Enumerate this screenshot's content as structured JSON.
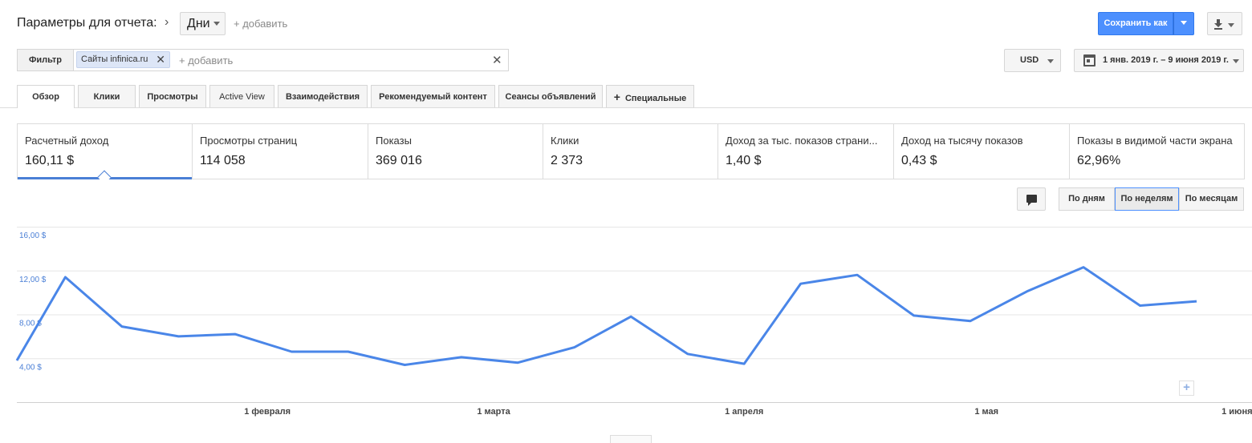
{
  "header": {
    "report_params_label": "Параметры для отчета:",
    "dimension_value": "Дни",
    "add_dimension": "+ добавить",
    "save_label": "Сохранить как"
  },
  "filter": {
    "label": "Фильтр",
    "chip_prefix": "Сайты ",
    "chip_value": "infinica.ru",
    "add_label": "+ добавить",
    "currency": "USD",
    "date_range": "1 янв. 2019 г. – 9 июня 2019 г."
  },
  "tabs": [
    {
      "label": "Обзор"
    },
    {
      "label": "Клики"
    },
    {
      "label": "Просмотры"
    },
    {
      "label": "Active View"
    },
    {
      "label": "Взаимодействия"
    },
    {
      "label": "Рекомендуемый контент"
    },
    {
      "label": "Сеансы объявлений"
    },
    {
      "label": "Специальные"
    }
  ],
  "metrics": [
    {
      "name": "Расчетный доход",
      "value": "160,11 $"
    },
    {
      "name": "Просмотры страниц",
      "value": "114 058"
    },
    {
      "name": "Показы",
      "value": "369 016"
    },
    {
      "name": "Клики",
      "value": "2 373"
    },
    {
      "name": "Доход за тыс. показов страни...",
      "value": "1,40 $"
    },
    {
      "name": "Доход на тысячу показов",
      "value": "0,43 $"
    },
    {
      "name": "Показы в видимой части экрана",
      "value": "62,96%"
    }
  ],
  "period_buttons": {
    "days": "По дням",
    "weeks": "По неделям",
    "months": "По месяцам",
    "selected": "weeks"
  },
  "colors": {
    "accent": "#4d90fe",
    "line": "#4a86e8",
    "axis_label": "#4a7fd6"
  },
  "icons": {
    "dimension_caret": "chevron-down-icon",
    "download": "download-icon",
    "calendar": "calendar-icon",
    "annotation": "comment-icon",
    "zoom": "plus-icon"
  },
  "chart_data": {
    "type": "line",
    "series": [
      {
        "values": [
          3.8,
          11.4,
          6.9,
          6.0,
          6.2,
          4.6,
          4.6,
          3.4,
          4.1,
          3.6,
          5.0,
          7.8,
          4.4,
          3.5,
          10.8,
          11.6,
          7.9,
          7.4,
          10.1,
          12.3,
          8.8,
          9.2
        ]
      }
    ],
    "x": [
      "2019-01-01",
      "2019-01-07",
      "2019-01-14",
      "2019-01-21",
      "2019-01-28",
      "2019-02-04",
      "2019-02-11",
      "2019-02-18",
      "2019-02-25",
      "2019-03-04",
      "2019-03-11",
      "2019-03-18",
      "2019-03-25",
      "2019-04-01",
      "2019-04-08",
      "2019-04-15",
      "2019-04-22",
      "2019-04-29",
      "2019-05-06",
      "2019-05-13",
      "2019-05-20",
      "2019-05-27"
    ],
    "x_tick_labels": [
      "1 февраля",
      "1 марта",
      "1 апреля",
      "1 мая",
      "1 июня"
    ],
    "y_tick_labels": [
      "16,00 $",
      "12,00 $",
      "8,00 $",
      "4,00 $"
    ],
    "y_ticks": [
      16,
      12,
      8,
      4
    ],
    "ylim": [
      0,
      16
    ],
    "grid": true
  }
}
